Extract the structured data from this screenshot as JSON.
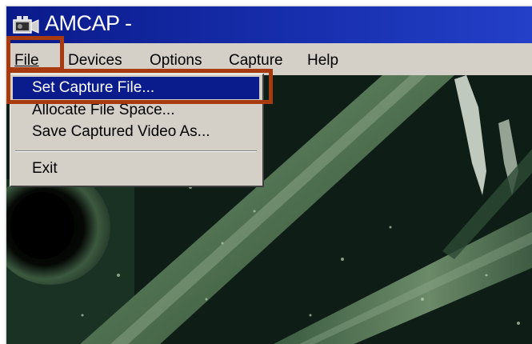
{
  "window": {
    "title": "AMCAP -",
    "icon": "amcap-app-icon"
  },
  "menubar": {
    "file": "File",
    "devices": "Devices",
    "options": "Options",
    "capture": "Capture",
    "help": "Help"
  },
  "file_menu": {
    "items": [
      {
        "label": "Set Capture File...",
        "selected": true
      },
      {
        "label": "Allocate File Space...",
        "selected": false
      },
      {
        "label": "Save Captured Video As...",
        "selected": false
      },
      {
        "label": "Exit",
        "selected": false
      }
    ]
  },
  "colors": {
    "titlebar": "#0a1a8a",
    "menu_selected": "#0a1c8c",
    "highlight_box": "#a83a10",
    "menu_bg": "#d4d0c8"
  }
}
